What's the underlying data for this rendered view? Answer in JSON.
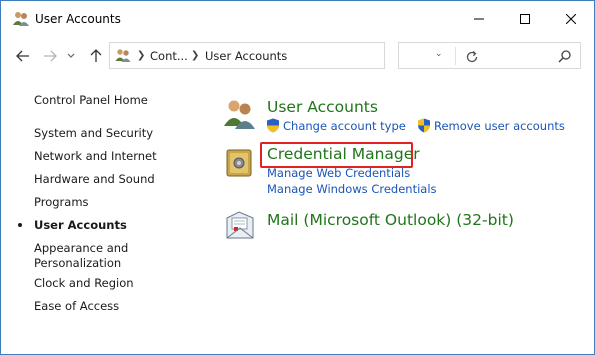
{
  "window": {
    "title": "User Accounts"
  },
  "address_bar": {
    "crumbs": [
      "Cont...",
      "User Accounts"
    ]
  },
  "search": {
    "placeholder": ""
  },
  "sidebar": {
    "home": "Control Panel Home",
    "items": [
      {
        "label": "System and Security"
      },
      {
        "label": "Network and Internet"
      },
      {
        "label": "Hardware and Sound"
      },
      {
        "label": "Programs"
      },
      {
        "label": "User Accounts",
        "current": true
      },
      {
        "label": "Appearance and\nPersonalization"
      },
      {
        "label": "Clock and Region"
      },
      {
        "label": "Ease of Access"
      }
    ]
  },
  "main": {
    "categories": [
      {
        "title": "User Accounts",
        "icon": "users-icon",
        "links": [
          "Change account type",
          "Remove user accounts"
        ]
      },
      {
        "title": "Credential Manager",
        "icon": "vault-icon",
        "links": [
          "Manage Web Credentials",
          "Manage Windows Credentials"
        ]
      },
      {
        "title": "Mail (Microsoft Outlook) (32-bit)",
        "icon": "mail-icon",
        "links": []
      }
    ]
  },
  "colors": {
    "category_green": "#21751b",
    "link_blue": "#1a55b8",
    "highlight_red": "#e02222",
    "window_border": "#3f7dbb"
  }
}
